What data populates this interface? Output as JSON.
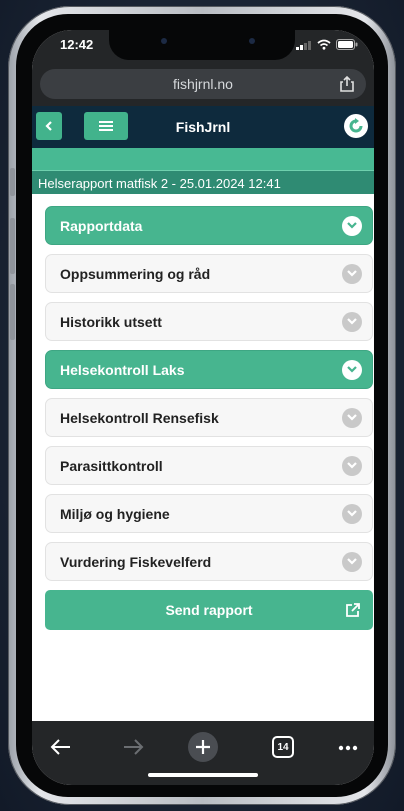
{
  "status_bar": {
    "time": "12:42"
  },
  "browser": {
    "url": "fishjrnl.no",
    "tab_count": "14"
  },
  "app": {
    "title": "FishJrnl"
  },
  "report": {
    "title": "Helserapport matfisk 2 - 25.01.2024 12:41"
  },
  "sections": [
    {
      "label": "Rapportdata",
      "expanded": true
    },
    {
      "label": "Oppsummering og råd",
      "expanded": false
    },
    {
      "label": "Historikk utsett",
      "expanded": false
    },
    {
      "label": "Helsekontroll Laks",
      "expanded": true
    },
    {
      "label": "Helsekontroll Rensefisk",
      "expanded": false
    },
    {
      "label": "Parasittkontroll",
      "expanded": false
    },
    {
      "label": "Miljø og hygiene",
      "expanded": false
    },
    {
      "label": "Vurdering Fiskevelferd",
      "expanded": false
    }
  ],
  "actions": {
    "send_label": "Send rapport"
  },
  "colors": {
    "accent": "#47b58f",
    "header": "#0e2a3d",
    "title_bar": "#2f8b73"
  }
}
